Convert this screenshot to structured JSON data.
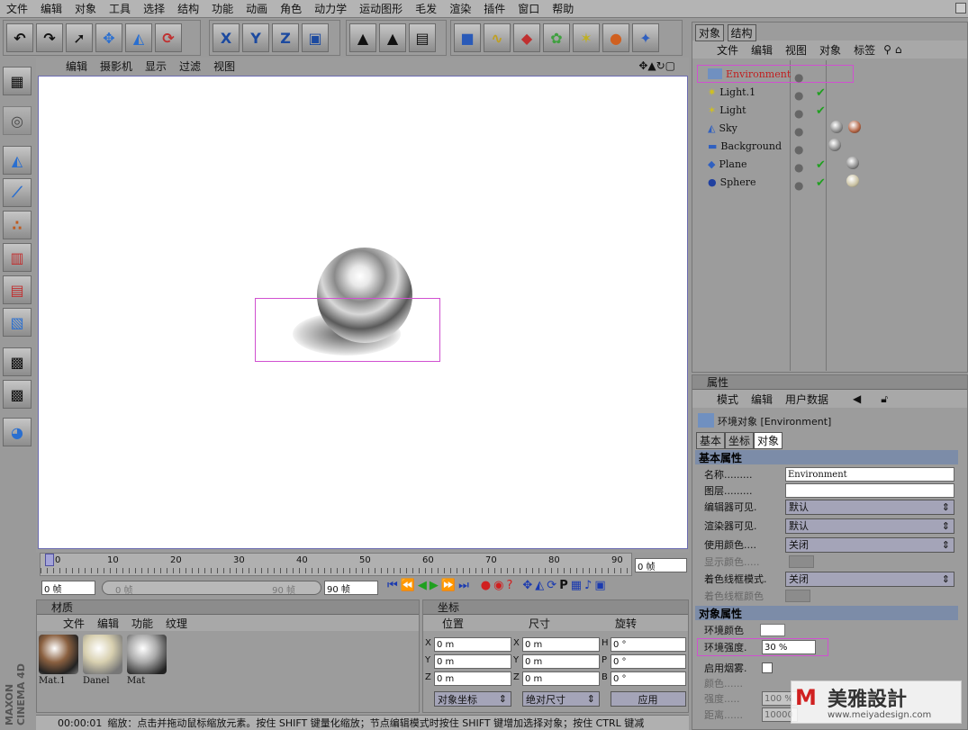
{
  "menu": [
    "文件",
    "编辑",
    "对象",
    "工具",
    "选择",
    "结构",
    "功能",
    "动画",
    "角色",
    "动力学",
    "运动图形",
    "毛发",
    "渲染",
    "插件",
    "窗口",
    "帮助"
  ],
  "viewport": {
    "menu": [
      "编辑",
      "摄影机",
      "显示",
      "过滤",
      "视图"
    ]
  },
  "timeline": {
    "ticks": [
      "0",
      "10",
      "20",
      "30",
      "40",
      "50",
      "60",
      "70",
      "80",
      "90"
    ],
    "frame_field": "0 帧",
    "start": "0 帧",
    "range_start": "0 帧",
    "range_end": "90 帧",
    "end": "90 帧"
  },
  "objects_panel": {
    "tabs": [
      "对象",
      "结构"
    ],
    "menu": [
      "文件",
      "编辑",
      "视图",
      "对象",
      "标签"
    ],
    "items": [
      "Environment",
      "Light.1",
      "Light",
      "Sky",
      "Background",
      "Plane",
      "Sphere"
    ]
  },
  "attributes": {
    "title": "属性",
    "menu": [
      "模式",
      "编辑",
      "用户数据"
    ],
    "object_title": "环境对象 [Environment]",
    "tabs": [
      "基本",
      "坐标",
      "对象"
    ],
    "basic_section": "基本属性",
    "rows": [
      {
        "label": "名称.........",
        "value": "Environment"
      },
      {
        "label": "图层.........",
        "value": ""
      },
      {
        "label": "编辑器可见.",
        "value": "默认"
      },
      {
        "label": "渲染器可见.",
        "value": "默认"
      },
      {
        "label": "使用颜色....",
        "value": "关闭"
      },
      {
        "label": "显示颜色.....",
        "value": ""
      },
      {
        "label": "着色线框模式.",
        "value": "关闭"
      },
      {
        "label": "着色线框颜色",
        "value": ""
      }
    ],
    "object_section": "对象属性",
    "env_color_label": "环境颜色",
    "env_strength_label": "环境强度.",
    "env_strength_value": "30 %",
    "fog_label": "启用烟雾.",
    "fog_color_label": "颜色......",
    "fog_strength_label": "强度.....",
    "fog_strength_value": "100 %",
    "fog_distance_label": "距离......",
    "fog_distance_value": "10000"
  },
  "materials": {
    "title": "材质",
    "menu": [
      "文件",
      "编辑",
      "功能",
      "纹理"
    ],
    "items": [
      "Mat.1",
      "Danel",
      "Mat"
    ]
  },
  "coords": {
    "title": "坐标",
    "headers": [
      "位置",
      "尺寸",
      "旋转"
    ],
    "rows": [
      {
        "a": "X",
        "pos": "0 m",
        "b": "X",
        "size": "0 m",
        "c": "H",
        "rot": "0 °"
      },
      {
        "a": "Y",
        "pos": "0 m",
        "b": "Y",
        "size": "0 m",
        "c": "P",
        "rot": "0 °"
      },
      {
        "a": "Z",
        "pos": "0 m",
        "b": "Z",
        "size": "0 m",
        "c": "B",
        "rot": "0 °"
      }
    ],
    "mode1": "对象坐标",
    "mode2": "绝对尺寸",
    "apply": "应用"
  },
  "status": {
    "time": "00:00:01",
    "text": "缩放：点击并拖动鼠标缩放元素。按住 SHIFT 键量化缩放；节点编辑模式时按住 SHIFT 键增加选择对象；按住 CTRL 键减"
  },
  "brand": {
    "logo_text": "MAXON CINEMA 4D",
    "watermark": "美雅設計",
    "watermark_url": "www.meiyadesign.com"
  }
}
